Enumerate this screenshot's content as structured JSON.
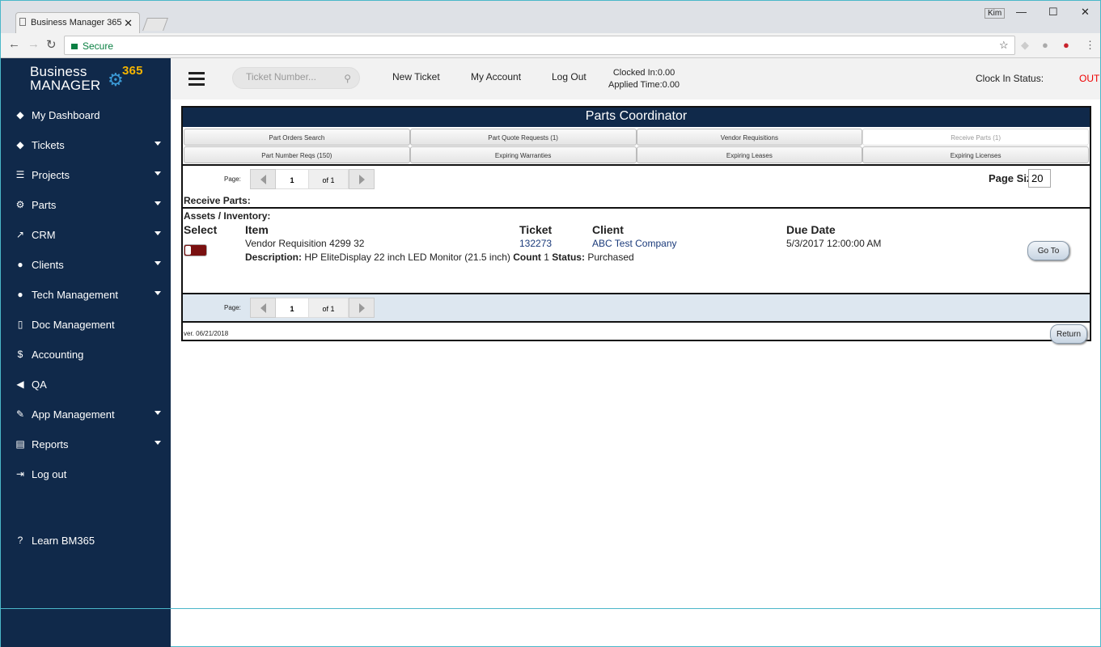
{
  "browser": {
    "tab_title": "Business Manager 365",
    "tab_close": "✕",
    "security_label": "Secure",
    "user_chip": "Kim",
    "window_controls": [
      "—",
      "☐",
      "✕"
    ]
  },
  "sidebar": {
    "logo_line1": "Business",
    "logo_line2": "MANAGER",
    "logo_number": "365",
    "items": [
      {
        "label": "My Dashboard",
        "icon": "tag-icon"
      },
      {
        "label": "Tickets",
        "icon": "tag-icon"
      },
      {
        "label": "Projects",
        "icon": "server-icon"
      },
      {
        "label": "Parts",
        "icon": "gears-icon"
      },
      {
        "label": "CRM",
        "icon": "chart-line-icon"
      },
      {
        "label": "Clients",
        "icon": "users-icon"
      },
      {
        "label": "Tech Management",
        "icon": "users-icon"
      },
      {
        "label": "Doc Management",
        "icon": "file-icon"
      },
      {
        "label": "Accounting",
        "icon": "dollar-icon"
      },
      {
        "label": "QA",
        "icon": "bullhorn-icon"
      },
      {
        "label": "App Management",
        "icon": "wrench-icon"
      },
      {
        "label": "Reports",
        "icon": "file-text-icon"
      },
      {
        "label": "Log out",
        "icon": "sign-out-icon"
      }
    ],
    "learn_label": "Learn BM365"
  },
  "header": {
    "search_placeholder": "Ticket Number...",
    "new_ticket": "New Ticket",
    "my_account": "My Account",
    "log_out": "Log Out",
    "clocked_in": "Clocked In:0.00",
    "applied_time": "Applied Time:0.00",
    "clock_in_status_label": "Clock In Status:",
    "clock_in_status_value": "OUT",
    "status_color": "#e00000"
  },
  "panel": {
    "title": "Parts Coordinator",
    "tabs_row1": [
      "Part Orders Search",
      "Part Quote Requests (1)",
      "Vendor Requisitions",
      "Receive Parts (1)"
    ],
    "tabs_row2": [
      "Part Number Reqs (150)",
      "Expiring Warranties",
      "Expiring Leases",
      "Expiring Licenses"
    ],
    "pager": {
      "label": "Page:",
      "current": "1",
      "of": "of 1"
    },
    "page_size_label": "Page Size:",
    "page_size_value": "20",
    "section_label": "Receive Parts:",
    "group_label": "Assets / Inventory:",
    "columns": {
      "select": "Select",
      "item": "Item",
      "ticket": "Ticket",
      "client": "Client",
      "due_date": "Due Date"
    },
    "row": {
      "item": "Vendor Requisition 4299 32",
      "ticket": "132273",
      "client": "ABC Test Company",
      "due_date": "5/3/2017 12:00:00 AM",
      "description_label": "Description:",
      "description": "HP EliteDisplay 22 inch LED Monitor (21.5 inch)",
      "count_label": "Count",
      "count": "1",
      "status_label": "Status:",
      "status": "Purchased",
      "goto_label": "Go To"
    },
    "version": "ver. 06/21/2018",
    "return_label": "Return"
  }
}
